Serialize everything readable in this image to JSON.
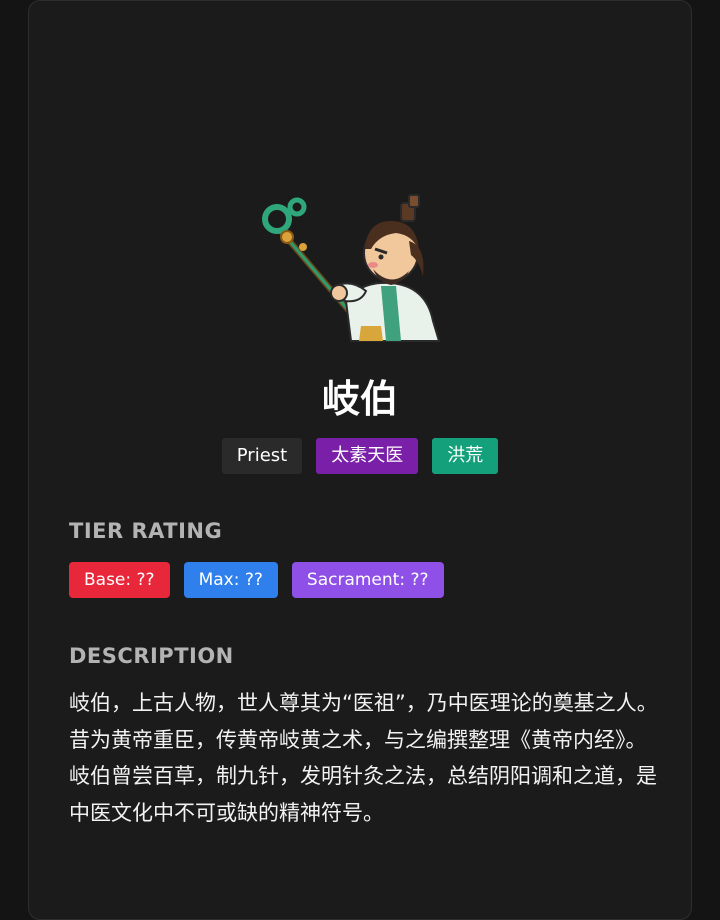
{
  "hero": {
    "name": "岐伯",
    "portrait": "chibi-sage-with-jade-staff",
    "tags": [
      {
        "label": "Priest",
        "color": "#2a2a2a"
      },
      {
        "label": "太素天医",
        "color": "#7a1fa8"
      },
      {
        "label": "洪荒",
        "color": "#13a07a"
      }
    ]
  },
  "tier": {
    "heading": "TIER RATING",
    "ratings": [
      {
        "label": "Base: ??",
        "color": "#e8273a"
      },
      {
        "label": "Max: ??",
        "color": "#2f80ed"
      },
      {
        "label": "Sacrament: ??",
        "color": "#8e50e6"
      }
    ]
  },
  "description": {
    "heading": "DESCRIPTION",
    "text": "岐伯，上古人物，世人尊其为“医祖”，乃中医理论的奠基之人。昔为黄帝重臣，传黄帝岐黄之术，与之编撰整理《黄帝内经》。岐伯曾尝百草，制九针，发明针灸之法，总结阴阳调和之道，是中医文化中不可或缺的精神符号。"
  }
}
